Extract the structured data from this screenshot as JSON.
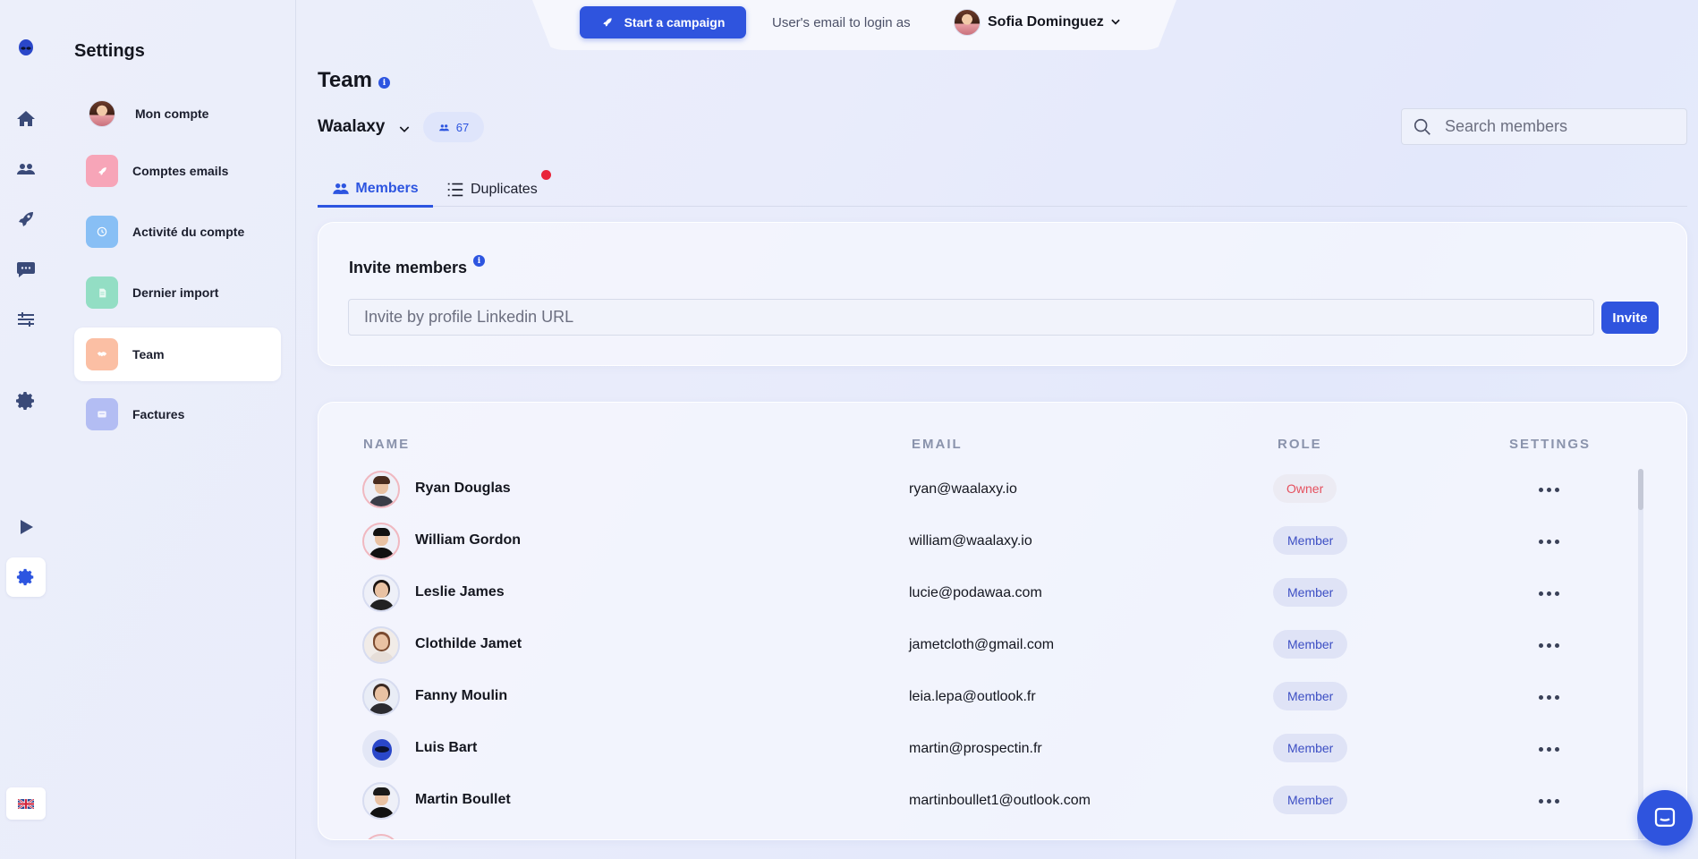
{
  "topbar": {
    "campaign_button": "Start a campaign",
    "login_as_label": "User's email to login as",
    "current_user": "Sofia Dominguez"
  },
  "settings": {
    "title": "Settings",
    "menu": [
      {
        "label": "Mon compte",
        "icon": "user-avatar",
        "color": ""
      },
      {
        "label": "Comptes emails",
        "icon": "rocket-icon",
        "color": "#f7a5b8"
      },
      {
        "label": "Activité du compte",
        "icon": "clock-icon",
        "color": "#88bff5"
      },
      {
        "label": "Dernier import",
        "icon": "document-icon",
        "color": "#93dec4"
      },
      {
        "label": "Team",
        "icon": "handshake-icon",
        "color": "#fbbfa4",
        "active": true
      },
      {
        "label": "Factures",
        "icon": "invoice-icon",
        "color": "#b3bdf3"
      }
    ]
  },
  "page": {
    "title": "Team",
    "organization": "Waalaxy",
    "member_count": "67",
    "search_placeholder": "Search members"
  },
  "tabs": {
    "members": "Members",
    "duplicates": "Duplicates"
  },
  "invite": {
    "title": "Invite members",
    "placeholder": "Invite by profile Linkedin URL",
    "button": "Invite"
  },
  "table": {
    "columns": {
      "name": "NAME",
      "email": "EMAIL",
      "role": "ROLE",
      "settings": "SETTINGS"
    },
    "rows": [
      {
        "name": "Ryan Douglas",
        "email": "ryan@waalaxy.io",
        "role": "Owner"
      },
      {
        "name": "William Gordon",
        "email": "william@waalaxy.io",
        "role": "Member"
      },
      {
        "name": "Leslie James",
        "email": "lucie@podawaa.com",
        "role": "Member"
      },
      {
        "name": "Clothilde Jamet",
        "email": "jametcloth@gmail.com",
        "role": "Member"
      },
      {
        "name": "Fanny Moulin",
        "email": "leia.lepa@outlook.fr",
        "role": "Member"
      },
      {
        "name": "Luis Bart",
        "email": "martin@prospectin.fr",
        "role": "Member"
      },
      {
        "name": "Martin Boullet",
        "email": "martinboullet1@outlook.com",
        "role": "Member"
      }
    ]
  },
  "colors": {
    "accent": "#2f54de",
    "owner_text": "#e5505e",
    "member_text": "#3d4fc4",
    "notification_dot": "#e8253a"
  }
}
